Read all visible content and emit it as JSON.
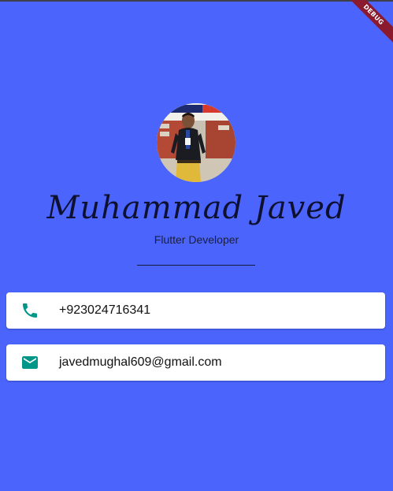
{
  "debug_banner": "DEBUG",
  "profile": {
    "name": "Muhammad Javed",
    "title": "Flutter Developer",
    "avatar_alt": "profile photo"
  },
  "contacts": {
    "phone": {
      "icon": "phone-icon",
      "value": "+923024716341"
    },
    "email": {
      "icon": "email-icon",
      "value": "javedmughal609@gmail.com"
    }
  },
  "colors": {
    "background": "#4a64fc",
    "card": "#ffffff",
    "icon": "#009688",
    "debug_ribbon": "#8b1a2e"
  }
}
